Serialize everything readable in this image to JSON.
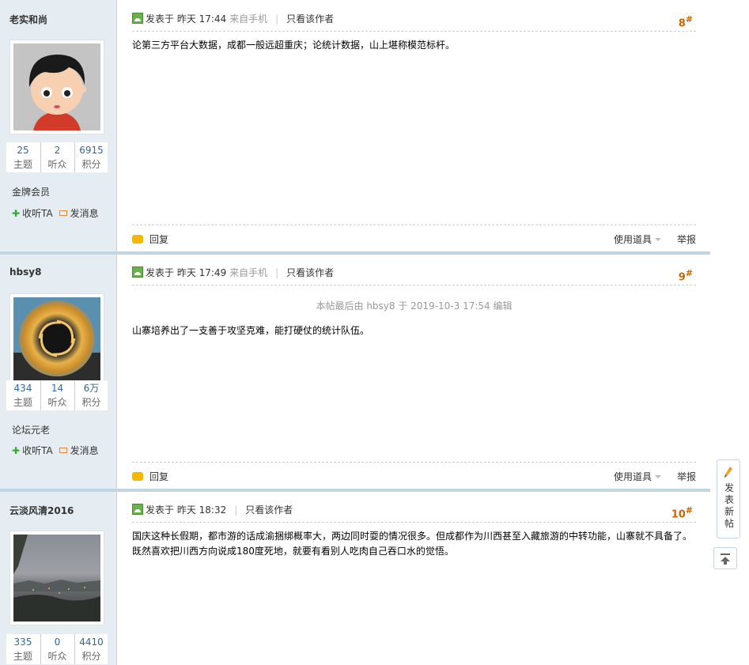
{
  "posts": [
    {
      "author": "老实和尚",
      "avatar_icon": "cartoon-boy-avatar",
      "stats": [
        {
          "value": "25",
          "label": "主题"
        },
        {
          "value": "2",
          "label": "听众"
        },
        {
          "value": "6915",
          "label": "积分"
        }
      ],
      "rank": "金牌会员",
      "follow": "收听TA",
      "message": "发消息",
      "header_prefix": "发表于",
      "time": "昨天 17:44",
      "source": "来自手机",
      "only_author": "只看该作者",
      "floor": "8",
      "floor_mark": "#",
      "edit_note": "",
      "content": "论第三方平台大数据，成都一般远超重庆；论统计数据，山上堪称模范标杆。",
      "reply": "回复",
      "tools": "使用道具",
      "report": "举报"
    },
    {
      "author": "hbsy8",
      "avatar_icon": "golden-ring-avatar",
      "stats": [
        {
          "value": "434",
          "label": "主题"
        },
        {
          "value": "14",
          "label": "听众"
        },
        {
          "value": "6万",
          "label": "积分"
        }
      ],
      "rank": "论坛元老",
      "follow": "收听TA",
      "message": "发消息",
      "header_prefix": "发表于",
      "time": "昨天 17:49",
      "source": "来自手机",
      "only_author": "只看该作者",
      "floor": "9",
      "floor_mark": "#",
      "edit_note": "本帖最后由 hbsy8 于 2019-10-3 17:54 编辑",
      "content": "山寨培养出了一支善于攻坚克难，能打硬仗的统计队伍。",
      "reply": "回复",
      "tools": "使用道具",
      "report": "举报"
    },
    {
      "author": "云淡风清2016",
      "avatar_icon": "city-landscape-avatar",
      "stats": [
        {
          "value": "335",
          "label": "主题"
        },
        {
          "value": "0",
          "label": "听众"
        },
        {
          "value": "4410",
          "label": "积分"
        }
      ],
      "header_prefix": "发表于",
      "time": "昨天 18:32",
      "source": "",
      "only_author": "只看该作者",
      "floor": "10",
      "floor_mark": "#",
      "content": "国庆这种长假期，都市游的话成渝捆绑概率大，两边同时耍的情况很多。但成都作为川西甚至入藏旅游的中转功能，山寨就不具备了。既然喜欢把川西方向说成180度死地，就要有看别人吃肉自己吞口水的觉悟。"
    }
  ],
  "float_new_post": "发表新帖",
  "icons": {
    "new_post": "pencil-icon",
    "back_to_top": "back-to-top-icon"
  },
  "colors": {
    "sidebar_bg": "#e5edf2",
    "floor_number": "#cc6600",
    "separator": "#c2d5e3"
  }
}
